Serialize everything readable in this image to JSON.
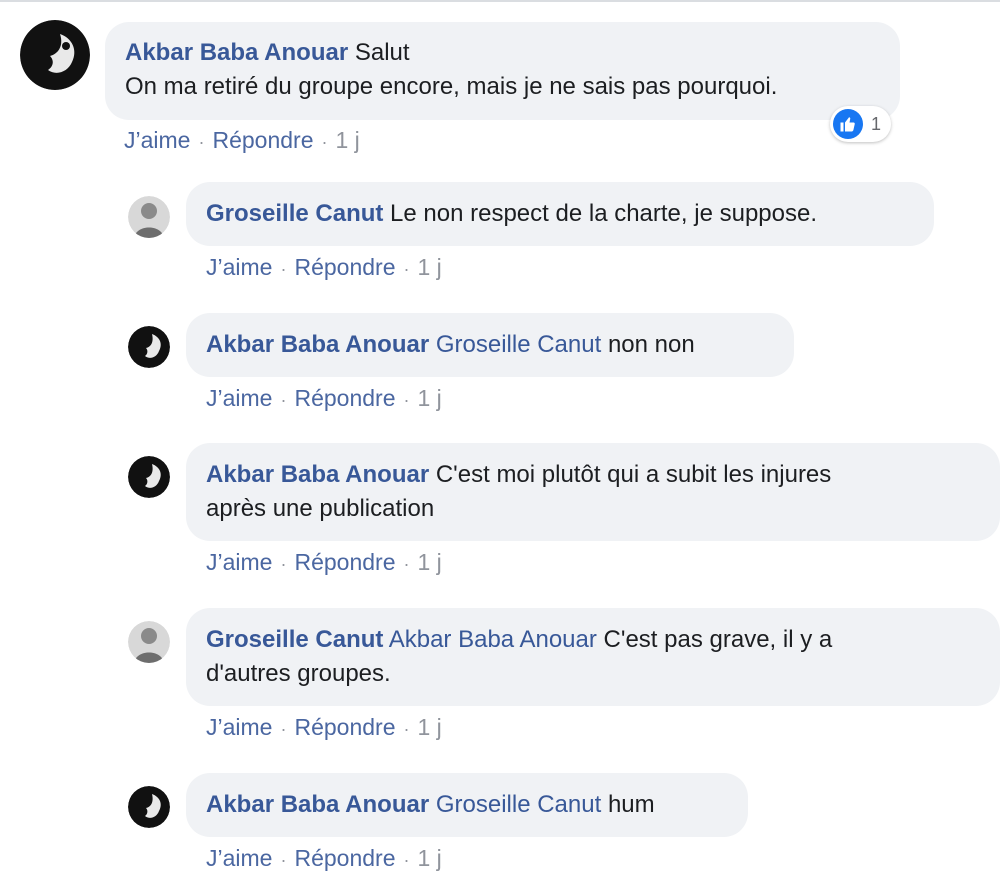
{
  "comments": [
    {
      "author": "Akbar Baba Anouar",
      "mention": "",
      "text_line1": "Salut",
      "text_line2": "On ma retiré du groupe encore, mais je ne sais pas pourquoi.",
      "like_label": "J’aime",
      "reply_label": "Répondre",
      "time": "1 j",
      "reaction_count": "1",
      "reaction_icon": "thumbs-up-icon"
    }
  ],
  "replies": [
    {
      "author": "Groseille Canut",
      "mention": "",
      "text_line1": "Le non respect de la charte, je suppose.",
      "text_line2": "",
      "like_label": "J’aime",
      "reply_label": "Répondre",
      "time": "1 j"
    },
    {
      "author": "Akbar Baba Anouar",
      "mention": "Groseille Canut",
      "text_line1": "non non",
      "text_line2": "",
      "like_label": "J’aime",
      "reply_label": "Répondre",
      "time": "1 j"
    },
    {
      "author": "Akbar Baba Anouar",
      "mention": "",
      "text_line1": "C'est moi plutôt qui a subit les injures",
      "text_line2": "après une publication",
      "like_label": "J’aime",
      "reply_label": "Répondre",
      "time": "1 j"
    },
    {
      "author": "Groseille Canut",
      "mention": "Akbar Baba Anouar",
      "text_line1": "C'est pas grave, il y a",
      "text_line2": "d'autres groupes.",
      "like_label": "J’aime",
      "reply_label": "Répondre",
      "time": "1 j"
    },
    {
      "author": "Akbar Baba Anouar",
      "mention": "Groseille Canut",
      "text_line1": "hum",
      "text_line2": "",
      "like_label": "J’aime",
      "reply_label": "Répondre",
      "time": "1 j"
    }
  ],
  "colors": {
    "author_link": "#385898",
    "bubble_bg": "#f0f2f5",
    "meta_text": "#90949c",
    "like_blue": "#1877f2"
  }
}
